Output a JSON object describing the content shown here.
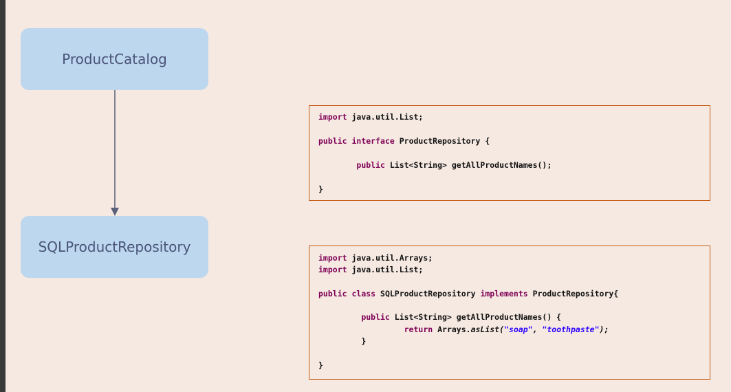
{
  "diagram": {
    "top_box": {
      "label": "ProductCatalog"
    },
    "bottom_box": {
      "label": "SQLProductRepository"
    }
  },
  "colors": {
    "background": "#f5e9e2",
    "box_fill": "#bdd7ee",
    "box_text": "#4a5478",
    "code_border": "#c55a11",
    "keyword": "#7f0055",
    "string": "#2a00ff",
    "arrow": "#5a6179"
  },
  "code_interface": {
    "import_kw": "import",
    "import_rest": " java.util.List;",
    "public_kw": "public",
    "interface_kw": "interface",
    "decl_rest": " ProductRepository {",
    "method_public": "public",
    "method_rest": " List<String> getAllProductNames();",
    "close": "}"
  },
  "code_class": {
    "import_kw": "import",
    "import1_rest": " java.util.Arrays;",
    "import2_rest": " java.util.List;",
    "public_kw": "public",
    "class_kw": "class",
    "class_name": " SQLProductRepository ",
    "implements_kw": "implements",
    "decl_rest": " ProductRepository{",
    "method_public": "public",
    "method_rest": " List<String> getAllProductNames() {",
    "return_kw": "return",
    "return_obj": " Arrays.",
    "aslist": "asList(",
    "str_soap": "\"soap\"",
    "comma": ", ",
    "str_toothpaste": "\"toothpaste\"",
    "end_call": ");",
    "method_close": "}",
    "close": "}"
  }
}
